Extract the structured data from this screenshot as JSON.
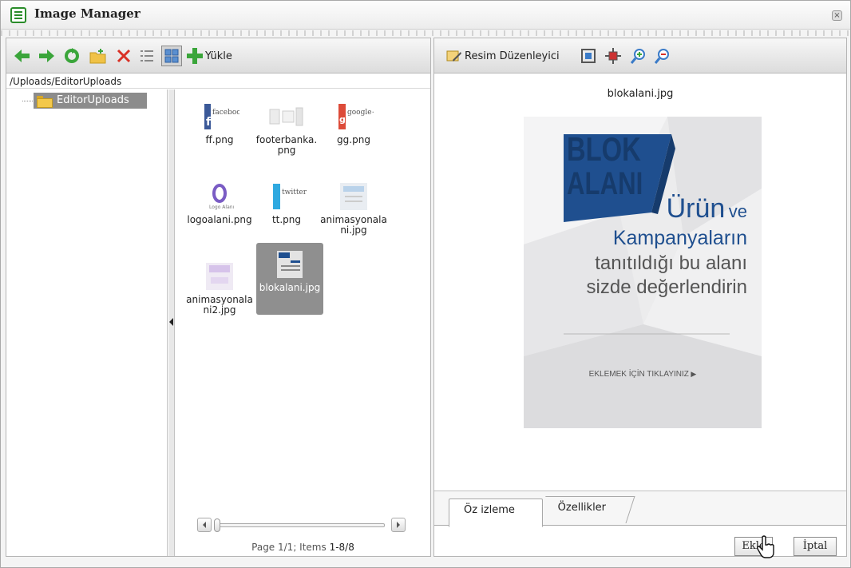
{
  "window": {
    "title": "Image Manager"
  },
  "toolbar_left": {
    "upload_label": "Yükle"
  },
  "toolbar_right": {
    "editor_label": "Resim Düzenleyici"
  },
  "path": "/Uploads/EditorUploads",
  "tree": {
    "root": "EditorUploads"
  },
  "files": [
    {
      "name": "ff.png",
      "thumb": "facebook"
    },
    {
      "name": "footerbanka.png",
      "thumb": "footer"
    },
    {
      "name": "gg.png",
      "thumb": "google+"
    },
    {
      "name": "logoalani.png",
      "thumb": "logo"
    },
    {
      "name": "tt.png",
      "thumb": "twitter"
    },
    {
      "name": "animasyonalani.jpg",
      "thumb": "anim1"
    },
    {
      "name": "animasyonalani2.jpg",
      "thumb": "anim2"
    },
    {
      "name": "blokalani.jpg",
      "thumb": "blok",
      "selected": true
    }
  ],
  "pager": {
    "text": "Page 1/1; Items ",
    "range": "1-8/8"
  },
  "preview": {
    "filename": "blokalani.jpg",
    "banner": {
      "logo_top": "BLOK",
      "logo_bottom": "ALANI",
      "line1_a": "Ürün",
      "line1_b": "ve",
      "line2": "Kampanyaların",
      "line3": "tanıtıldığı bu alanı",
      "line4": "sizde değerlendirin",
      "cta": "EKLEMEK İÇİN TIKLAYINIZ"
    }
  },
  "tabs": [
    {
      "label": "Öz izleme"
    },
    {
      "label": "Özellikler"
    }
  ],
  "buttons": {
    "insert": "Ekle",
    "cancel": "İptal"
  },
  "colors": {
    "arrow_green": "#3aa53a",
    "delete_red": "#d93025",
    "selection_gray": "#8c8c8c",
    "logo_blue": "#1f4f8f"
  }
}
